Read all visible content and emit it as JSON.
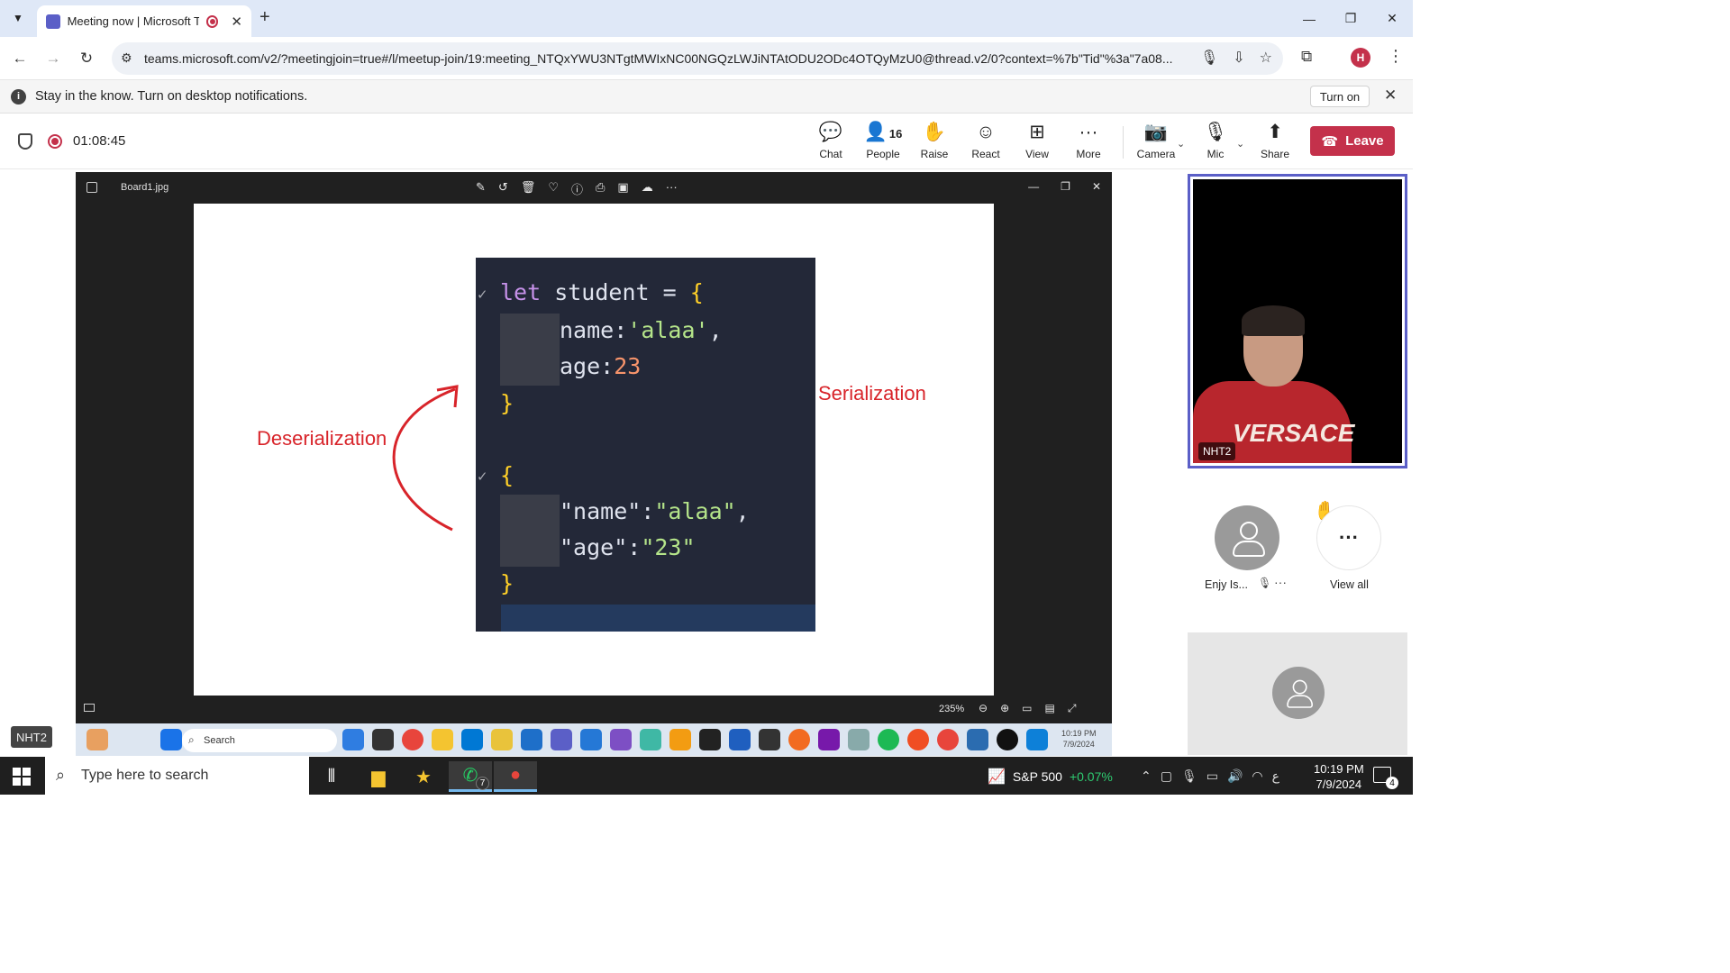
{
  "browser": {
    "tab_title": "Meeting now | Microsoft Teams",
    "url": "teams.microsoft.com/v2/?meetingjoin=true#/l/meetup-join/19:meeting_NTQxYWU3NTgtMWIxNC00NGQzLWJiNTAtODU2ODc4OTQyMzU0@thread.v2/0?context=%7b\"Tid\"%3a\"7a08...",
    "profile_initial": "H"
  },
  "notification": {
    "message": "Stay in the know. Turn on desktop notifications.",
    "button": "Turn on"
  },
  "meeting": {
    "timer": "01:08:45",
    "people_count": "16",
    "buttons": {
      "chat": "Chat",
      "people": "People",
      "raise": "Raise",
      "react": "React",
      "view": "View",
      "more": "More",
      "camera": "Camera",
      "mic": "Mic",
      "share": "Share",
      "leave": "Leave"
    }
  },
  "viewer": {
    "filename": "Board1.jpg",
    "zoom": "235%"
  },
  "whiteboard": {
    "deserialization_label": "Deserialization",
    "serialization_label": "Serialization",
    "code": {
      "line1_kw": "let",
      "line1_id": " student = ",
      "line1_brace": "{",
      "line2_key": "name:",
      "line2_val": "'alaa'",
      "line2_comma": ",",
      "line3_key": "age:",
      "line3_val": "23",
      "line4_brace": "}",
      "line5_brace": "{",
      "line6_key": "\"name\":",
      "line6_val": "\"alaa\"",
      "line6_comma": ",",
      "line7_key": "\"age\":",
      "line7_val": "\"23\"",
      "line8_brace": "}"
    }
  },
  "shared_screen": {
    "presenter_tag": "NHT2",
    "search_placeholder": "Search",
    "time": "10:19 PM",
    "date": "7/9/2024"
  },
  "participants": {
    "main_video_name": "NHT2",
    "shirt_text": "VERSACE",
    "second_name": "Enjy Is...",
    "view_all": "View all"
  },
  "taskbar": {
    "search_placeholder": "Type here to search",
    "whatsapp_badge": "7",
    "stock_name": "S&P 500",
    "stock_change": "+0.07%",
    "time": "10:19 PM",
    "date": "7/9/2024",
    "notification_count": "4"
  },
  "colors": {
    "leave_red": "#c4314b",
    "teams_accent": "#5b5fc7",
    "annotation_red": "#d8242a"
  }
}
